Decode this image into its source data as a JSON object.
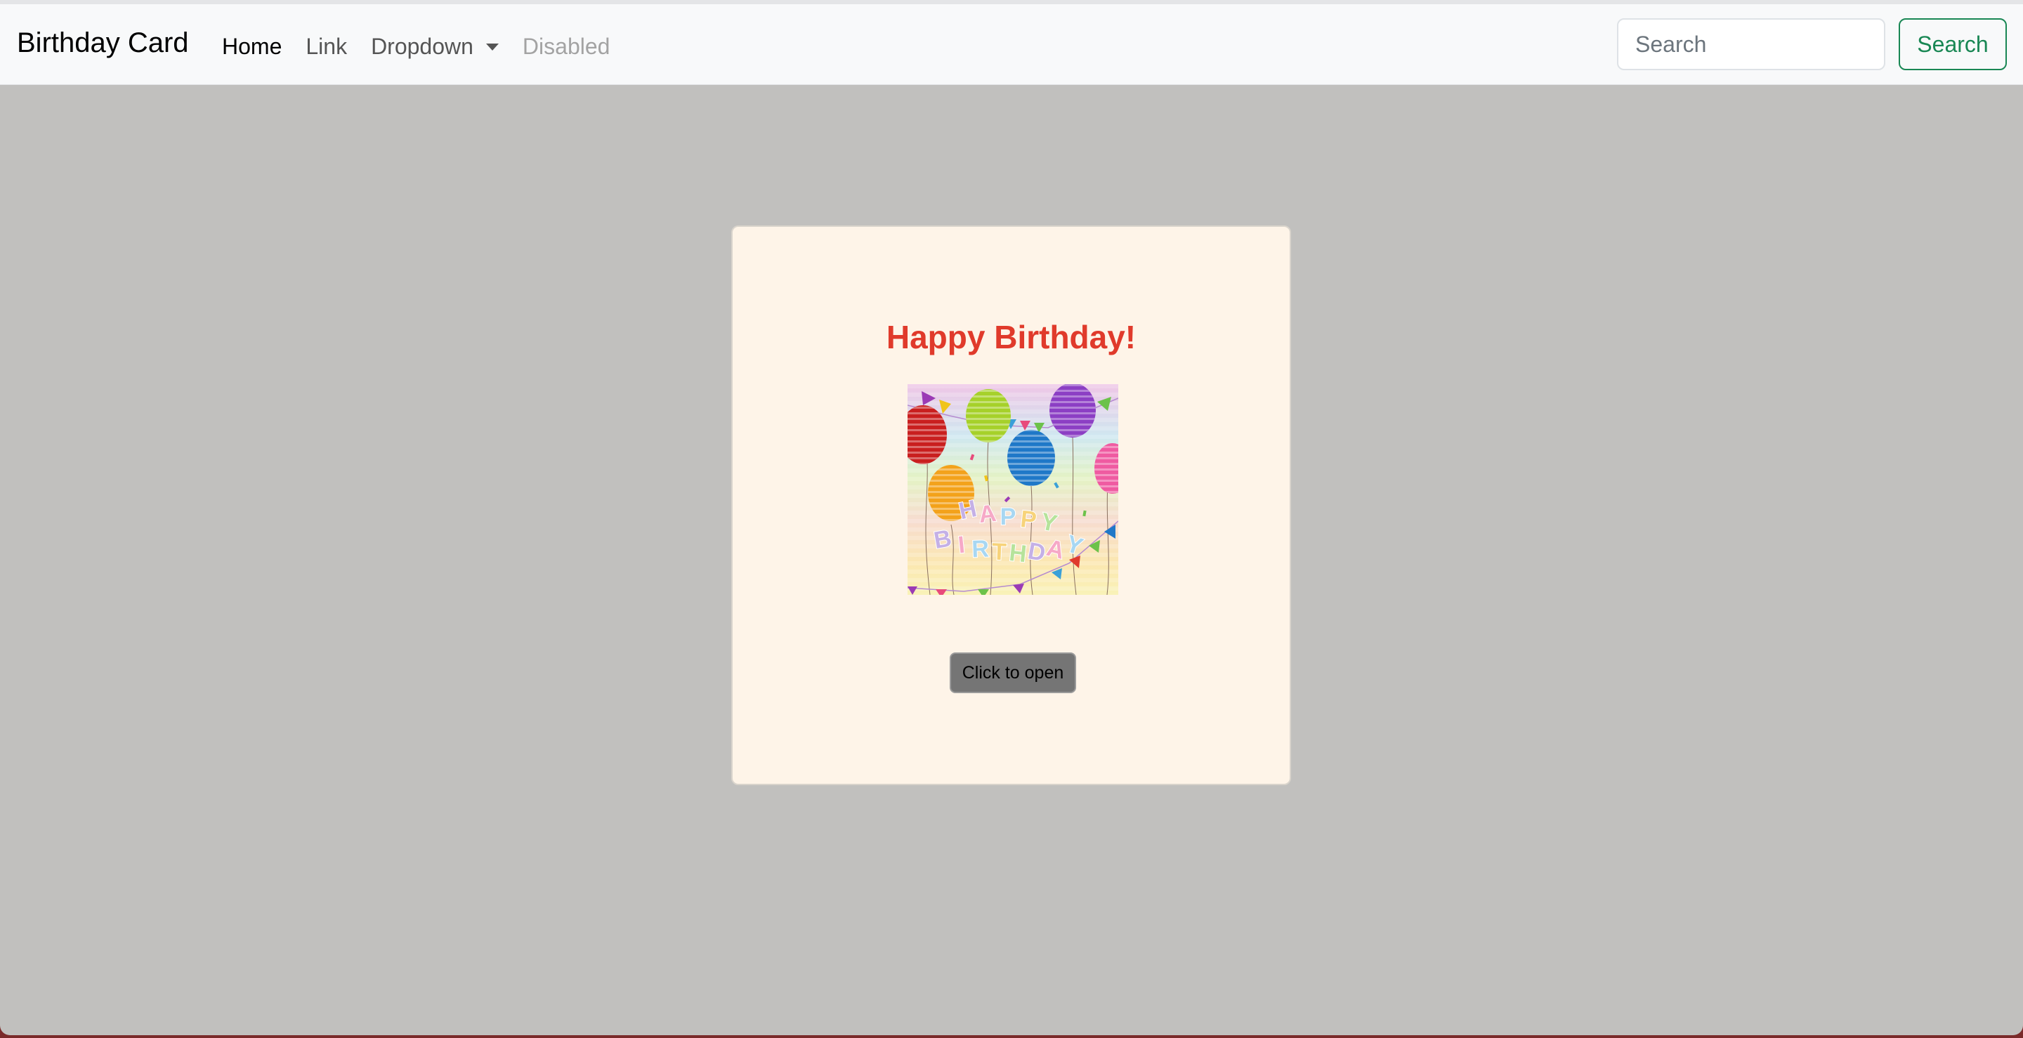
{
  "navbar": {
    "brand": "Birthday Card",
    "links": [
      "Home",
      "Link",
      "Dropdown",
      "Disabled"
    ],
    "search_placeholder": "Search",
    "search_button": "Search"
  },
  "card": {
    "title": "Happy Birthday!",
    "image_letters": [
      "H",
      "A",
      "P",
      "P",
      "Y",
      "B",
      "I",
      "R",
      "T",
      "H",
      "D",
      "A",
      "Y"
    ],
    "button_label": "Click to open"
  },
  "colors": {
    "page_background": "#c1c0be",
    "card_background": "#fef4e8",
    "title": "#e03a2b",
    "search_accent": "#198754",
    "button_background": "#757575"
  }
}
